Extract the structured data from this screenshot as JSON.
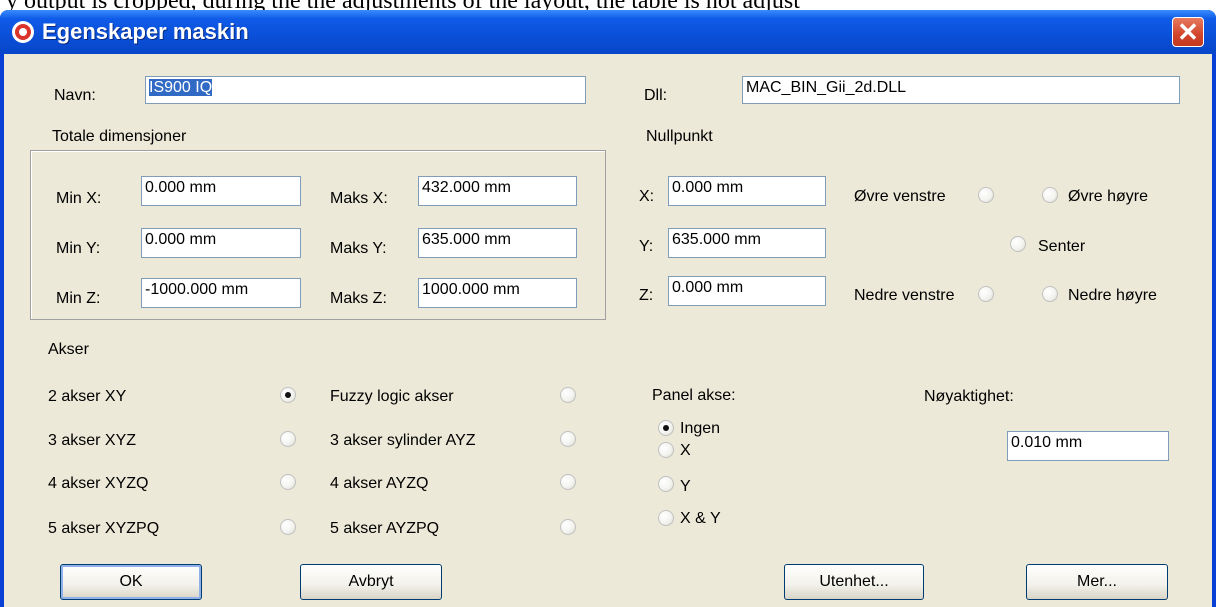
{
  "background_text": "y output is cropped, during the the adjustments of the layout, the table is not adjust",
  "window": {
    "title": "Egenskaper maskin",
    "close_glyph": "✕"
  },
  "name": {
    "label": "Navn:",
    "value": "IS900 IQ"
  },
  "dll": {
    "label": "Dll:",
    "value": "MAC_BIN_Gii_2d.DLL"
  },
  "dimensions": {
    "title": "Totale dimensjoner",
    "min_x": {
      "label": "Min X:",
      "value": "0.000 mm"
    },
    "min_y": {
      "label": "Min Y:",
      "value": "0.000 mm"
    },
    "min_z": {
      "label": "Min Z:",
      "value": "-1000.000 mm"
    },
    "max_x": {
      "label": "Maks X:",
      "value": "432.000 mm"
    },
    "max_y": {
      "label": "Maks Y:",
      "value": "635.000 mm"
    },
    "max_z": {
      "label": "Maks Z:",
      "value": "1000.000 mm"
    }
  },
  "origin": {
    "title": "Nullpunkt",
    "x": {
      "label": "X:",
      "value": "0.000 mm"
    },
    "y": {
      "label": "Y:",
      "value": "635.000 mm"
    },
    "z": {
      "label": "Z:",
      "value": "0.000 mm"
    },
    "upper_left": "Øvre venstre",
    "upper_right": "Øvre høyre",
    "center": "Senter",
    "lower_left": "Nedre venstre",
    "lower_right": "Nedre høyre"
  },
  "axes": {
    "title": "Akser",
    "xy2": "2 akser XY",
    "xyz3": "3 akser XYZ",
    "xyzq4": "4 akser XYZQ",
    "xyzpq5": "5 akser XYZPQ",
    "fuzzy": "Fuzzy logic akser",
    "cyl_ayz3": "3 akser sylinder AYZ",
    "ayzq4": "4 akser AYZQ",
    "ayzpq5": "5 akser AYZPQ",
    "selected": "2 akser XY"
  },
  "panel_axis": {
    "title": "Panel akse:",
    "none": "Ingen",
    "x": "X",
    "y": "Y",
    "xy": "X & Y",
    "selected": "Ingen"
  },
  "precision": {
    "label": "Nøyaktighet:",
    "value": "0.010 mm"
  },
  "buttons": {
    "ok": "OK",
    "cancel": "Avbryt",
    "units": "Utenhet...",
    "more": "Mer..."
  }
}
